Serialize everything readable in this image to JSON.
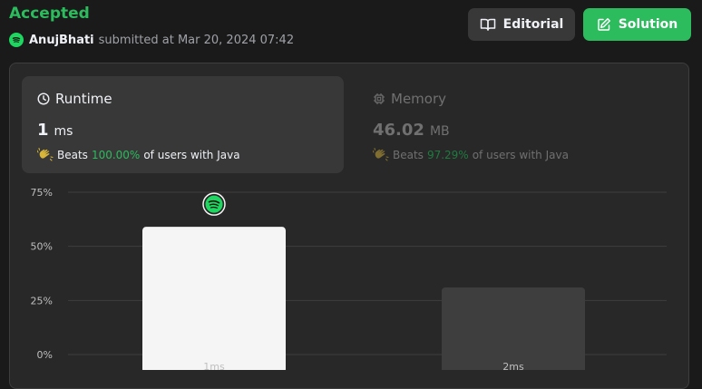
{
  "header": {
    "status": "Accepted",
    "username": "AnujBhati",
    "submitted_text": "submitted at Mar 20, 2024 07:42"
  },
  "buttons": {
    "editorial_label": "Editorial",
    "solution_label": "Solution"
  },
  "runtime": {
    "title": "Runtime",
    "value": "1",
    "unit": "ms",
    "beats_label": "Beats",
    "beats_pct": "100.00%",
    "beats_suffix": "of users with Java"
  },
  "memory": {
    "title": "Memory",
    "value": "46.02",
    "unit": "MB",
    "beats_label": "Beats",
    "beats_pct": "97.29%",
    "beats_suffix": "of users with Java"
  },
  "colors": {
    "accent": "#2cbb5d",
    "background": "#1a1a1a",
    "panel": "#282828",
    "card": "#383838",
    "highlight_bar": "#f5f5f5",
    "other_bar": "#3e3e3e"
  },
  "chart_data": {
    "type": "bar",
    "categories": [
      "1ms",
      "2ms"
    ],
    "values": [
      59,
      31
    ],
    "yticks": [
      "0%",
      "25%",
      "50%",
      "75%"
    ],
    "ylim": [
      0,
      75
    ],
    "highlight_index": 0,
    "grid": true
  }
}
